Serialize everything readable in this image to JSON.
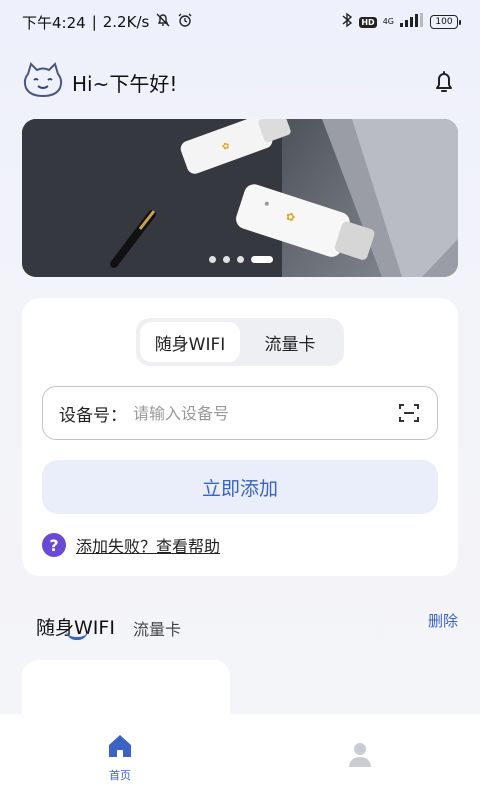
{
  "status_bar": {
    "time": "下午4:24",
    "separator": "|",
    "speed": "2.2K/s",
    "hd": "HD",
    "net_type": "4G",
    "battery": "100"
  },
  "header": {
    "greeting": "Hi~下午好!"
  },
  "banner": {
    "dot_count": 4,
    "active_index": 3
  },
  "bind_card": {
    "tabs": [
      {
        "label": "随身WIFI",
        "active": true
      },
      {
        "label": "流量卡",
        "active": false
      }
    ],
    "device_label": "设备号：",
    "device_placeholder": "请输入设备号",
    "add_button": "立即添加",
    "help_icon": "?",
    "help_text": "添加失败？查看帮助"
  },
  "device_list": {
    "tabs": [
      {
        "label": "随身WIFI",
        "active": true
      },
      {
        "label": "流量卡",
        "active": false
      }
    ],
    "delete_label": "删除"
  },
  "bottom_nav": {
    "items": [
      {
        "label": "首页",
        "icon": "home-icon",
        "active": true
      },
      {
        "label": "",
        "icon": "profile-icon",
        "active": false
      }
    ]
  },
  "colors": {
    "accent": "#3b63c4",
    "help_purple": "#6a49d6",
    "add_button_bg": "#e9eefa"
  }
}
